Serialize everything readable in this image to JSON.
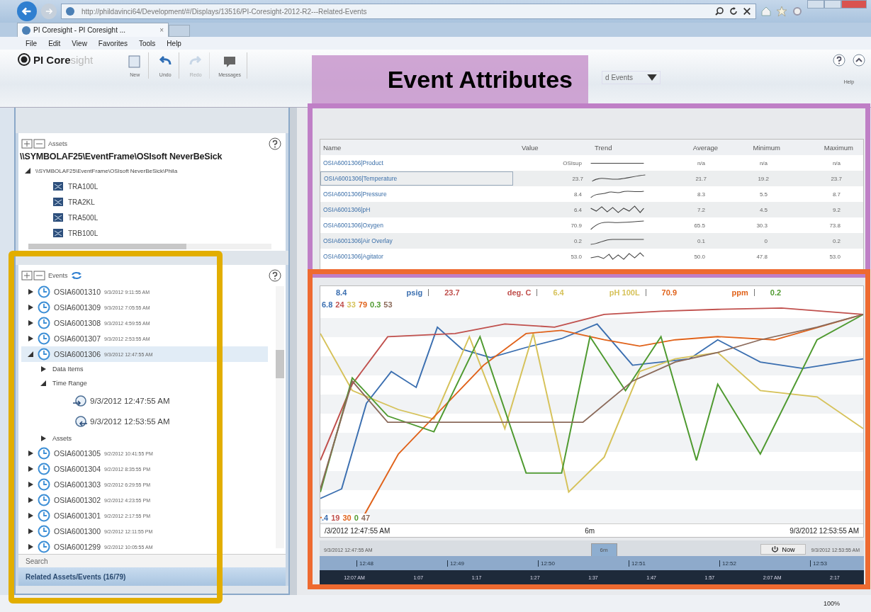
{
  "browser": {
    "url": "http://phildavinci64/Development/#/Displays/13516/PI-Coresight-2012-R2---Related-Events",
    "tab": {
      "title": "PI Coresight - PI Coresight ...",
      "close": "×",
      "selected": true
    },
    "menu": [
      "File",
      "Edit",
      "View",
      "Favorites",
      "Tools",
      "Help"
    ],
    "zoom": "100%"
  },
  "app": {
    "logo": {
      "bold": "PI Core",
      "light": "sight"
    },
    "toolbar": [
      {
        "label": "New",
        "disabled": false
      },
      {
        "label": "Undo",
        "disabled": false
      },
      {
        "label": "Redo",
        "disabled": true
      },
      {
        "label": "Messages",
        "disabled": false
      }
    ],
    "display_menu": "d Events",
    "help": "Help"
  },
  "annotation": "Event Attributes",
  "assets": {
    "title": "Assets",
    "path": "\\\\SYMBOLAF25\\EventFrame\\OSIsoft NeverBeSick",
    "tree": [
      {
        "label": "\\\\SYMBOLAF25\\EventFrame\\OSIsoft NeverBeSick\\Phila",
        "expanded": true,
        "children": [
          {
            "label": "TRA100L"
          },
          {
            "label": "TRA2KL"
          },
          {
            "label": "TRA500L"
          },
          {
            "label": "TRB100L"
          }
        ]
      }
    ]
  },
  "events": {
    "title": "Events",
    "items": [
      {
        "kind": "event",
        "id": "OSIA6001310",
        "time": "9/3/2012 9:11:55 AM",
        "expanded": false,
        "selected": false
      },
      {
        "kind": "event",
        "id": "OSIA6001309",
        "time": "9/3/2012 7:05:55 AM",
        "expanded": false,
        "selected": false
      },
      {
        "kind": "event",
        "id": "OSIA6001308",
        "time": "9/3/2012 4:59:55 AM",
        "expanded": false,
        "selected": false
      },
      {
        "kind": "event",
        "id": "OSIA6001307",
        "time": "9/3/2012 2:53:55 AM",
        "expanded": false,
        "selected": false
      },
      {
        "kind": "event",
        "id": "OSIA6001306",
        "time": "9/3/2012 12:47:55 AM",
        "expanded": true,
        "selected": true,
        "children": [
          {
            "kind": "group",
            "label": "Data Items",
            "expanded": false
          },
          {
            "kind": "group",
            "label": "Time Range",
            "expanded": true,
            "children": [
              {
                "kind": "start",
                "label": "9/3/2012 12:47:55 AM"
              },
              {
                "kind": "end",
                "label": "9/3/2012 12:53:55 AM"
              }
            ]
          },
          {
            "kind": "group",
            "label": "Assets",
            "expanded": false
          }
        ]
      },
      {
        "kind": "event",
        "id": "OSIA6001305",
        "time": "9/2/2012 10:41:55 PM",
        "expanded": false,
        "selected": false
      },
      {
        "kind": "event",
        "id": "OSIA6001304",
        "time": "9/2/2012 8:35:55 PM",
        "expanded": false,
        "selected": false
      },
      {
        "kind": "event",
        "id": "OSIA6001303",
        "time": "9/2/2012 6:29:55 PM",
        "expanded": false,
        "selected": false
      },
      {
        "kind": "event",
        "id": "OSIA6001302",
        "time": "9/2/2012 4:23:55 PM",
        "expanded": false,
        "selected": false
      },
      {
        "kind": "event",
        "id": "OSIA6001301",
        "time": "9/2/2012 2:17:55 PM",
        "expanded": false,
        "selected": false
      },
      {
        "kind": "event",
        "id": "OSIA6001300",
        "time": "9/2/2012 12:11:55 PM",
        "expanded": false,
        "selected": false
      },
      {
        "kind": "event",
        "id": "OSIA6001299",
        "time": "9/2/2012 10:05:55 AM",
        "expanded": false,
        "selected": false
      }
    ],
    "search": "Search",
    "related": "Related Assets/Events (16/79)"
  },
  "table": {
    "columns": [
      "Name",
      "Value",
      "Trend",
      "Average",
      "Minimum",
      "Maximum"
    ],
    "rows": [
      {
        "name": "OSIA6001306|Product",
        "value": "OSIsup",
        "average": "n/a",
        "minimum": "n/a",
        "maximum": "n/a",
        "selected": false
      },
      {
        "name": "OSIA6001306|Temperature",
        "value": "23.7",
        "average": "21.7",
        "minimum": "19.2",
        "maximum": "23.7",
        "selected": true
      },
      {
        "name": "OSIA6001306|Pressure",
        "value": "8.4",
        "average": "8.3",
        "minimum": "5.5",
        "maximum": "8.7",
        "selected": false
      },
      {
        "name": "OSIA6001306|pH",
        "value": "6.4",
        "average": "7.2",
        "minimum": "4.5",
        "maximum": "9.2",
        "selected": false
      },
      {
        "name": "OSIA6001306|Oxygen",
        "value": "70.9",
        "average": "65.5",
        "minimum": "30.3",
        "maximum": "73.8",
        "selected": false
      },
      {
        "name": "OSIA6001306|Air Overlay",
        "value": "0.2",
        "average": "0.1",
        "minimum": "0",
        "maximum": "0.2",
        "selected": false
      },
      {
        "name": "OSIA6001306|Agitator",
        "value": "53.0",
        "average": "50.0",
        "minimum": "47.8",
        "maximum": "53.0",
        "selected": false
      }
    ]
  },
  "chart": {
    "legend": [
      {
        "value": "8.4",
        "unit": "psig",
        "color": "#3b6fb0"
      },
      {
        "value": "23.7",
        "unit": "deg. C",
        "color": "#c0504d"
      },
      {
        "value": "6.4",
        "unit": "pH 100L",
        "color": "#d6c25a"
      },
      {
        "value": "70.9",
        "unit": "ppm",
        "color": "#e0621a"
      },
      {
        "value": "0.2",
        "color": "#4f9a30"
      }
    ],
    "scale_top": [
      {
        "text": "6.8",
        "color": "#3b6fb0"
      },
      {
        "text": "24",
        "color": "#c0504d"
      },
      {
        "text": "33",
        "color": "#d6c25a"
      },
      {
        "text": "79",
        "color": "#e0621a"
      },
      {
        "text": "0.3",
        "color": "#4f9a30"
      },
      {
        "text": "53",
        "color": "#8b6a5a"
      }
    ],
    "scale_bottom": [
      {
        "text": ".4",
        "color": "#3b6fb0"
      },
      {
        "text": "19",
        "color": "#c0504d"
      },
      {
        "text": "30",
        "color": "#e0621a"
      },
      {
        "text": "0",
        "color": "#4f9a30"
      },
      {
        "text": "47",
        "color": "#8b6a5a"
      }
    ],
    "start": "/3/2012 12:47:55 AM",
    "span": "6m",
    "end": "9/3/2012 12:53:55 AM"
  },
  "timebar": {
    "start": "9/3/2012 12:47:55 AM",
    "tabs": [
      {
        "label": "6m",
        "selected": true
      }
    ],
    "now": "Now",
    "end": "9/3/2012 12:53:55 AM",
    "ticks": [
      "12:48",
      "12:49",
      "12:50",
      "12:51",
      "12:52",
      "12:53"
    ],
    "overview": [
      "12:07 AM",
      "1:07",
      "1:17",
      "1:27",
      "1:37",
      "1:47",
      "1:57",
      "2:07 AM",
      "2:17"
    ]
  }
}
